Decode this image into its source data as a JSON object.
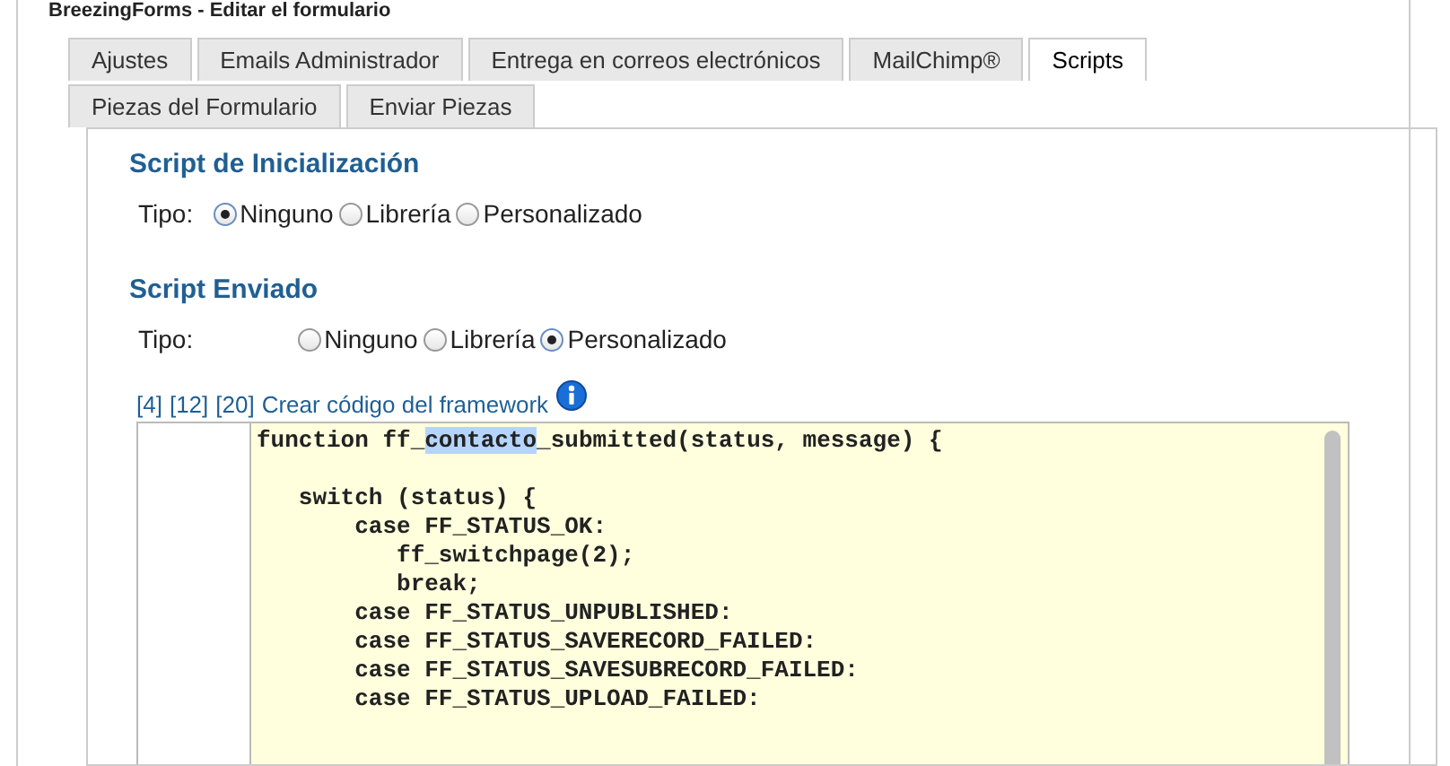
{
  "page_title": "BreezingForms - Editar el formulario",
  "tabs": [
    {
      "label": "Ajustes",
      "selected": false
    },
    {
      "label": "Emails Administrador",
      "selected": false
    },
    {
      "label": "Entrega en correos electrónicos",
      "selected": false
    },
    {
      "label": "MailChimp®",
      "selected": false
    },
    {
      "label": "Scripts",
      "selected": true
    },
    {
      "label": "Piezas del Formulario",
      "selected": false
    },
    {
      "label": "Enviar Piezas",
      "selected": false
    }
  ],
  "sections": [
    {
      "title": "Script de Inicialización",
      "type_label": "Tipo:",
      "options": [
        {
          "label": "Ninguno",
          "selected": true
        },
        {
          "label": "Librería",
          "selected": false
        },
        {
          "label": "Personalizado",
          "selected": false
        }
      ]
    },
    {
      "title": "Script Enviado",
      "type_label": "Tipo:",
      "options": [
        {
          "label": "Ninguno",
          "selected": false
        },
        {
          "label": "Librería",
          "selected": false
        },
        {
          "label": "Personalizado",
          "selected": true
        }
      ]
    }
  ],
  "code_links": [
    "[4]",
    "[12]",
    "[20]",
    "Crear código del framework"
  ],
  "code_blocks": [
    [
      {
        "parts": [
          {
            "text": "function ff_",
            "selected": false
          },
          {
            "text": "contacto",
            "selected": true
          },
          {
            "text": "_submitted(status, message) {",
            "selected": false
          }
        ]
      }
    ],
    [
      {
        "parts": [
          {
            "text": "   switch (status) {",
            "selected": false
          }
        ]
      },
      {
        "parts": [
          {
            "text": "       case FF_STATUS_OK:",
            "selected": false
          }
        ]
      },
      {
        "parts": [
          {
            "text": "          ff_switchpage(2);",
            "selected": false
          }
        ]
      },
      {
        "parts": [
          {
            "text": "          break;",
            "selected": false
          }
        ]
      },
      {
        "parts": [
          {
            "text": "       case FF_STATUS_UNPUBLISHED:",
            "selected": false
          }
        ]
      },
      {
        "parts": [
          {
            "text": "       case FF_STATUS_SAVERECORD_FAILED:",
            "selected": false
          }
        ]
      },
      {
        "parts": [
          {
            "text": "       case FF_STATUS_SAVESUBRECORD_FAILED:",
            "selected": false
          }
        ]
      },
      {
        "parts": [
          {
            "text": "       case FF_STATUS_UPLOAD_FAILED:",
            "selected": false
          }
        ]
      }
    ]
  ]
}
